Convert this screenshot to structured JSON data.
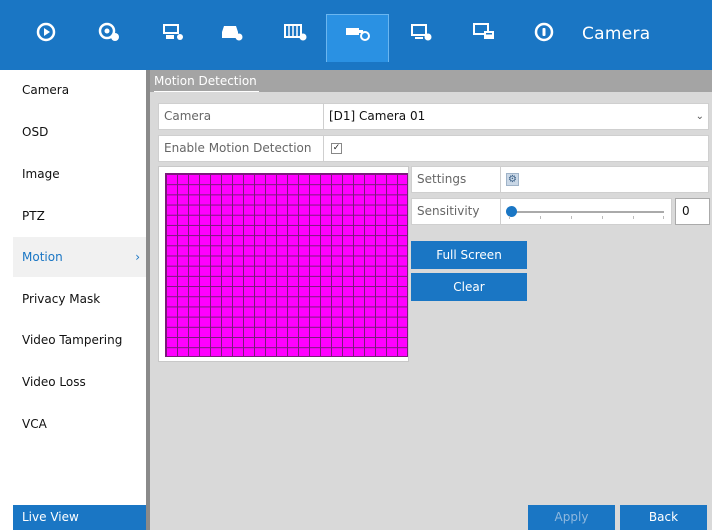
{
  "topbar": {
    "title": "Camera",
    "icons": [
      "playback-icon",
      "camera-manage-icon",
      "record-icon",
      "storage-icon",
      "video-settings-icon",
      "camera-settings-icon",
      "network-icon",
      "system-icon",
      "info-icon"
    ],
    "active_icon": "camera-settings-icon"
  },
  "sidebar": {
    "items": [
      {
        "label": "Camera"
      },
      {
        "label": "OSD"
      },
      {
        "label": "Image"
      },
      {
        "label": "PTZ"
      },
      {
        "label": "Motion",
        "active": true
      },
      {
        "label": "Privacy Mask"
      },
      {
        "label": "Video Tampering"
      },
      {
        "label": "Video Loss"
      },
      {
        "label": "VCA"
      }
    ],
    "live_view": "Live View",
    "active_chevron": "›"
  },
  "section": {
    "title": "Motion Detection"
  },
  "form": {
    "camera_label": "Camera",
    "camera_value": "[D1] Camera 01",
    "enable_label": "Enable Motion Detection",
    "enable_checked": true
  },
  "settings": {
    "settings_label": "Settings",
    "sensitivity_label": "Sensitivity",
    "sensitivity_value": "0"
  },
  "buttons": {
    "full_screen": "Full Screen",
    "clear": "Clear",
    "apply": "Apply",
    "back": "Back"
  },
  "colors": {
    "accent": "#1a76c4",
    "grid_fill": "#ff00ff"
  }
}
